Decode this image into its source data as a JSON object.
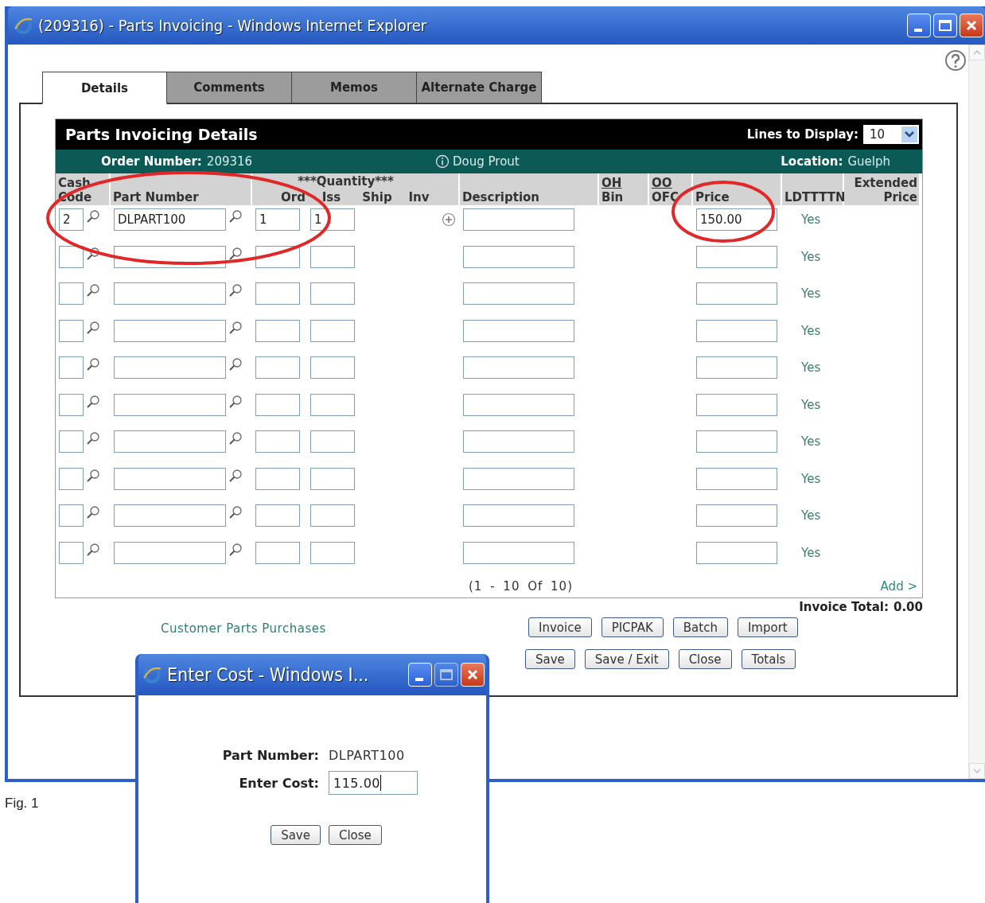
{
  "window": {
    "title": "(209316) - Parts Invoicing - Windows Internet Explorer"
  },
  "tabs": [
    {
      "label": "Details",
      "selected": true
    },
    {
      "label": "Comments",
      "selected": false
    },
    {
      "label": "Memos",
      "selected": false
    },
    {
      "label": "Alternate Charge",
      "selected": false
    }
  ],
  "panel": {
    "title": "Parts Invoicing Details",
    "lines_label": "Lines to Display:",
    "lines_value": "10",
    "order_label": "Order Number:",
    "order_value": "209316",
    "user": "Doug Prout",
    "location_label": "Location:",
    "location_value": "Guelph"
  },
  "table": {
    "columns": {
      "cash": "Cash Code",
      "part": "Part Number",
      "quantity": "***Quantity***",
      "ord": "Ord",
      "iss": "Iss",
      "ship": "Ship",
      "inv": "Inv",
      "description": "Description",
      "oh": "OH",
      "oh_sub": "Bin",
      "oo": "OO",
      "oo_sub": "OFC",
      "price": "Price",
      "ldtttn": "LDTTTTN",
      "extended": "Extended Price"
    },
    "rows": [
      {
        "cash_code": "2",
        "part_number": "DLPART100",
        "ord": "1",
        "iss": "1",
        "add_icon": true,
        "price": "150.00",
        "ldtttn": "Yes"
      },
      {
        "add_icon": false,
        "ldtttn": "Yes"
      },
      {
        "add_icon": false,
        "ldtttn": "Yes"
      },
      {
        "add_icon": false,
        "ldtttn": "Yes"
      },
      {
        "add_icon": false,
        "ldtttn": "Yes"
      },
      {
        "add_icon": false,
        "ldtttn": "Yes"
      },
      {
        "add_icon": false,
        "ldtttn": "Yes"
      },
      {
        "add_icon": false,
        "ldtttn": "Yes"
      },
      {
        "add_icon": false,
        "ldtttn": "Yes"
      },
      {
        "add_icon": false,
        "ldtttn": "Yes"
      }
    ],
    "range": "(1 - 10 Of 10)",
    "add_link": "Add >"
  },
  "invoice_total": {
    "label": "Invoice Total:",
    "value": "0.00"
  },
  "link": "Customer Parts Purchases",
  "button_rows": [
    [
      "Invoice",
      "PICPAK",
      "Batch",
      "Import"
    ],
    [
      "Save",
      "Save / Exit",
      "Close",
      "Totals"
    ]
  ],
  "dialog": {
    "title": "Enter Cost - Windows I...",
    "part_label": "Part Number:",
    "part_value": "DLPART100",
    "cost_label": "Enter Cost:",
    "cost_value": "115.00",
    "buttons": [
      "Save",
      "Close"
    ]
  },
  "caption": "Fig. 1"
}
